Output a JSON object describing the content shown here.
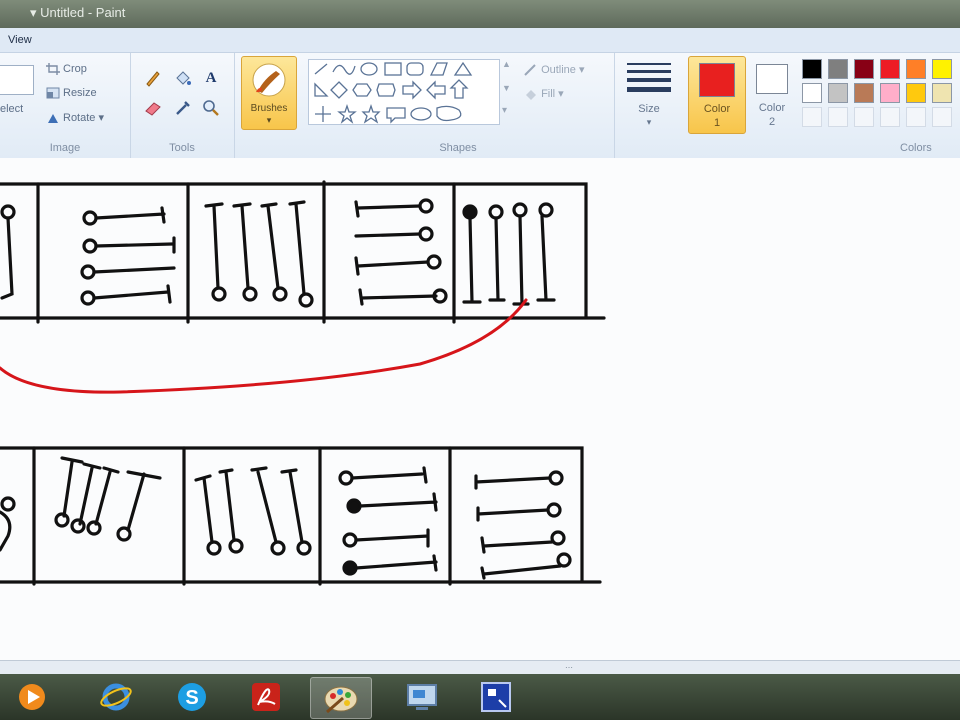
{
  "window": {
    "title": "▾  Untitled - Paint"
  },
  "menu": {
    "view_tab": "View"
  },
  "ribbon": {
    "select_label": "elect",
    "image_group": {
      "label": "Image",
      "crop": "Crop",
      "resize": "Resize",
      "rotate": "Rotate ▾"
    },
    "tools_group": {
      "label": "Tools",
      "text_tool": "A"
    },
    "brushes": {
      "label": "Brushes",
      "arrow": "▾"
    },
    "shapes_group": {
      "label": "Shapes",
      "outline": "Outline ▾",
      "fill": "Fill ▾"
    },
    "size": {
      "label": "Size",
      "arrow": "▾"
    },
    "color1": {
      "label": "Color",
      "num": "1",
      "value": "#e8201f"
    },
    "color2": {
      "label": "Color",
      "num": "2",
      "value": "#ffffff"
    },
    "colors_group": {
      "label": "Colors"
    },
    "palette_row1": [
      "#000000",
      "#7f7f7f",
      "#880015",
      "#ed1c24",
      "#ff7f27",
      "#fff200"
    ],
    "palette_row2": [
      "#ffffff",
      "#c3c3c3",
      "#b97a57",
      "#ffaec9",
      "#ffc90e",
      "#efe4b0"
    ]
  },
  "status": {
    "grip": "⋯"
  },
  "taskbar": {
    "apps": [
      "media-player",
      "internet-explorer",
      "skype",
      "adobe-reader",
      "paint",
      "remote-desktop",
      "window-capture"
    ]
  }
}
